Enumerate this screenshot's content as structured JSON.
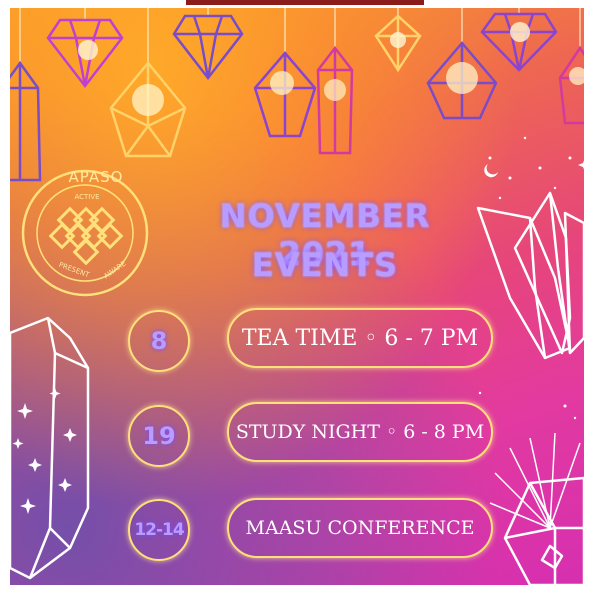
{
  "logo": {
    "name": "APASO",
    "words": [
      "ACTIVE",
      "PRESENT",
      "AWARE"
    ]
  },
  "title": {
    "line1": "NOVEMBER 2021",
    "line2": "EVENTS"
  },
  "events": [
    {
      "date": "8",
      "label": "TEA TIME ◦ 6 - 7 PM"
    },
    {
      "date": "19",
      "label": "STUDY NIGHT ◦ 6 - 8 PM"
    },
    {
      "date": "12-14",
      "label": "MAASU CONFERENCE"
    }
  ],
  "colors": {
    "accent_gold": "#ffe07a",
    "title_purple": "#b99cff",
    "top_bar": "#8a1c1c"
  }
}
